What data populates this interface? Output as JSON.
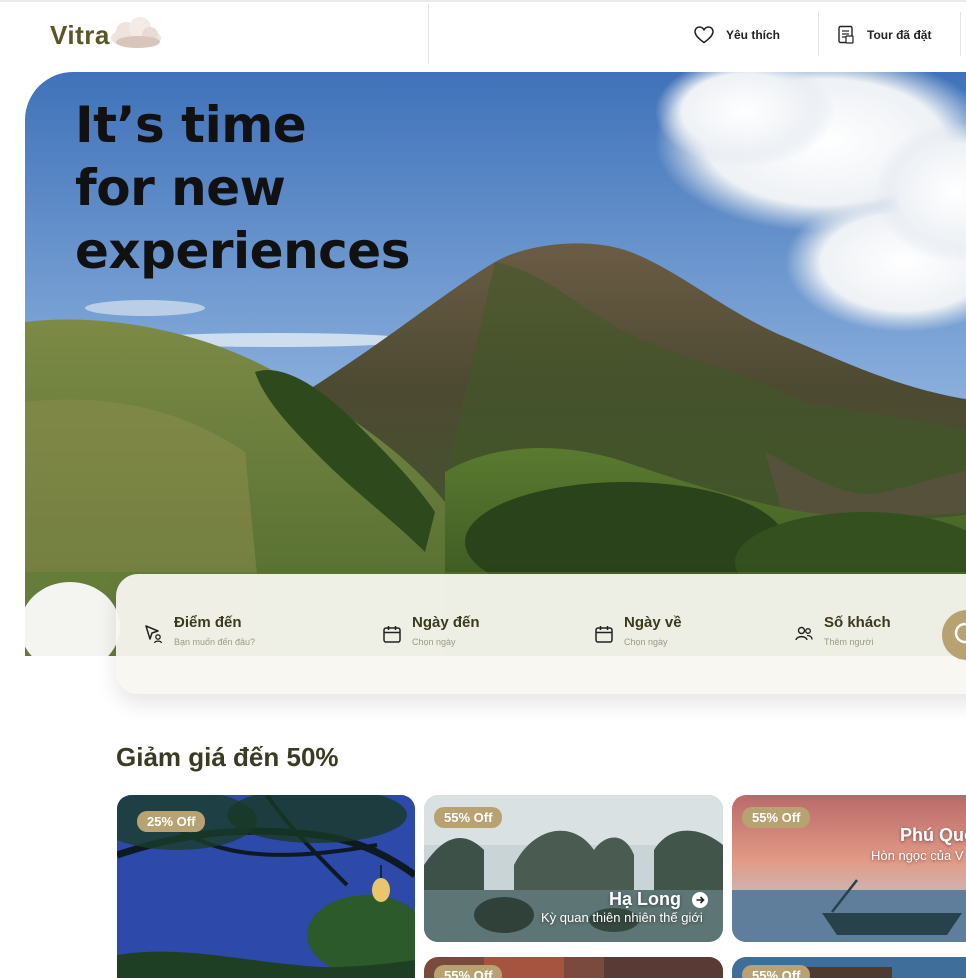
{
  "brand": {
    "name": "Vitra"
  },
  "nav": {
    "favorites_label": "Yêu thích",
    "booked_label": "Tour đã đặt"
  },
  "hero": {
    "title_line1": "It’s time",
    "title_line2": "for new",
    "title_line3": "experiences"
  },
  "search": {
    "destination_label": "Điểm đến",
    "destination_hint": "Bạn muốn đến đâu?",
    "checkin_label": "Ngày đến",
    "checkin_hint": "Chọn ngày",
    "checkout_label": "Ngày về",
    "checkout_hint": "Chọn ngày",
    "guests_label": "Số khách",
    "guests_hint": "Thêm người"
  },
  "deals": {
    "title": "Giảm giá đến 50%",
    "cards": [
      {
        "badge": "25% Off"
      },
      {
        "badge": "55% Off",
        "title": "Hạ Long",
        "subtitle": "Kỳ quan thiên nhiên thế giới"
      },
      {
        "badge": "55% Off",
        "title": "Phú Quố",
        "subtitle": "Hòn ngọc của V"
      },
      {
        "badge": "55% Off"
      },
      {
        "badge": "55% Off"
      }
    ]
  },
  "colors": {
    "accent": "#b8a272",
    "brand_text": "#5b5528",
    "heading_text": "#3b3a22"
  },
  "icons": [
    "heart-icon",
    "receipt-icon",
    "location-pin-icon",
    "calendar-icon",
    "users-icon",
    "search-icon",
    "arrow-right-icon"
  ]
}
